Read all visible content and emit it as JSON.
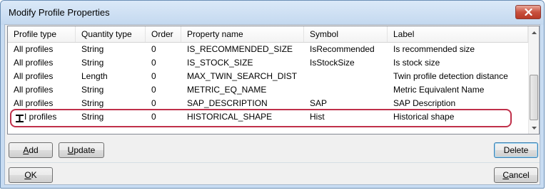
{
  "window": {
    "title": "Modify Profile Properties"
  },
  "table": {
    "columns": [
      "Profile type",
      "Quantity type",
      "Order",
      "Property name",
      "Symbol",
      "Label"
    ],
    "rows": [
      [
        "All profiles",
        "String",
        "0",
        "IS_RECOMMENDED_SIZE",
        "IsRecommended",
        "Is recommended size"
      ],
      [
        "All profiles",
        "String",
        "0",
        "IS_STOCK_SIZE",
        "IsStockSize",
        "Is stock size"
      ],
      [
        "All profiles",
        "Length",
        "0",
        "MAX_TWIN_SEARCH_DIST",
        "",
        "Twin profile detection distance"
      ],
      [
        "All profiles",
        "String",
        "0",
        "METRIC_EQ_NAME",
        "",
        "Metric Equivalent Name"
      ],
      [
        "All profiles",
        "String",
        "0",
        "SAP_DESCRIPTION",
        "SAP",
        "SAP Description"
      ],
      [
        "I profiles",
        "String",
        "0",
        "HISTORICAL_SHAPE",
        "Hist",
        "Historical shape"
      ]
    ]
  },
  "buttons": {
    "add": {
      "mnemonic": "A",
      "rest": "dd"
    },
    "update": {
      "mnemonic": "U",
      "rest": "pdate"
    },
    "delete": "Delete",
    "ok": {
      "mnemonic": "O",
      "rest": "K"
    },
    "cancel": {
      "mnemonic": "C",
      "rest": "ancel"
    }
  },
  "icons": {
    "close": "close-icon",
    "row_icon": "i-profile-icon",
    "scroll_up": "scroll-up-arrow-icon",
    "scroll_down": "scroll-down-arrow-icon"
  },
  "colors": {
    "highlight_outline": "#c0304a",
    "title_bar": "#c8dcf2",
    "close_button": "#c9513f"
  }
}
